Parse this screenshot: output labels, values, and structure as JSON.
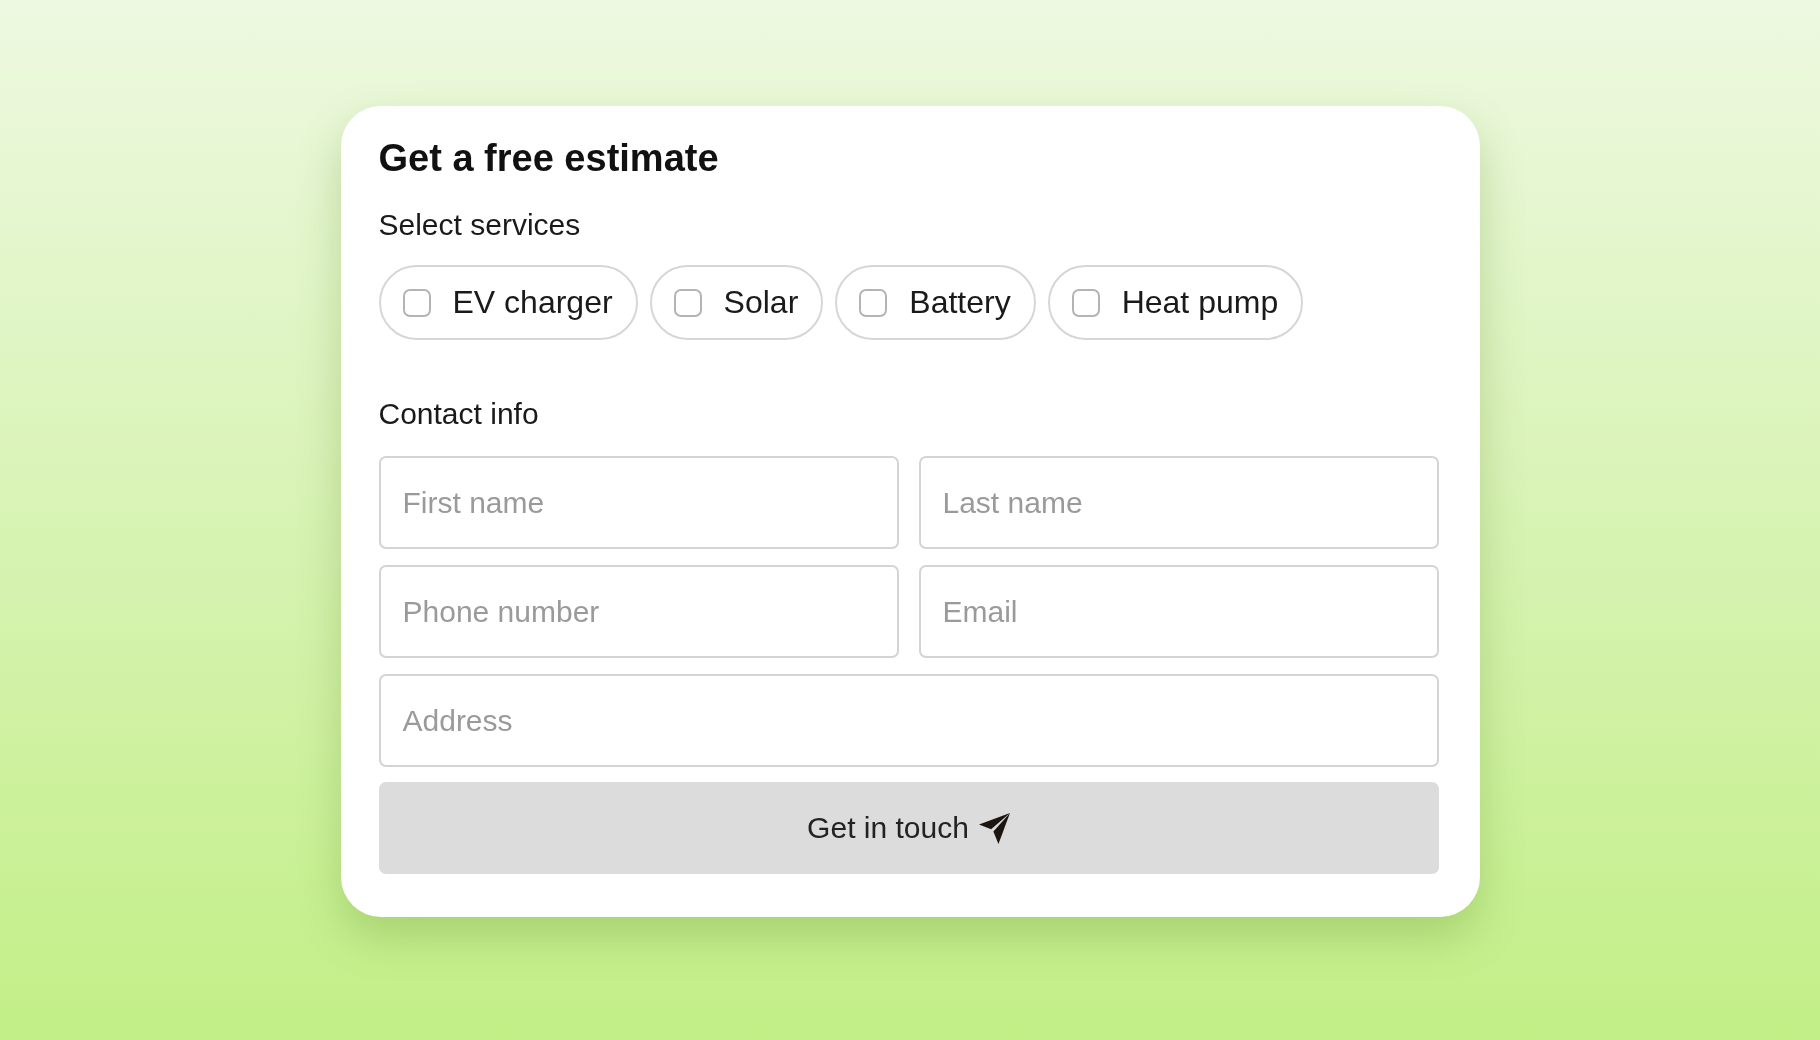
{
  "form": {
    "title": "Get a free estimate",
    "services_label": "Select services",
    "services": [
      {
        "label": "EV charger",
        "checked": false
      },
      {
        "label": "Solar",
        "checked": false
      },
      {
        "label": "Battery",
        "checked": false
      },
      {
        "label": "Heat pump",
        "checked": false
      }
    ],
    "contact_label": "Contact info",
    "fields": [
      {
        "placeholder": "First name"
      },
      {
        "placeholder": "Last name"
      },
      {
        "placeholder": "Phone number"
      },
      {
        "placeholder": "Email"
      },
      {
        "placeholder": "Address"
      }
    ],
    "submit_button": {
      "label": "Get in touch"
    }
  }
}
